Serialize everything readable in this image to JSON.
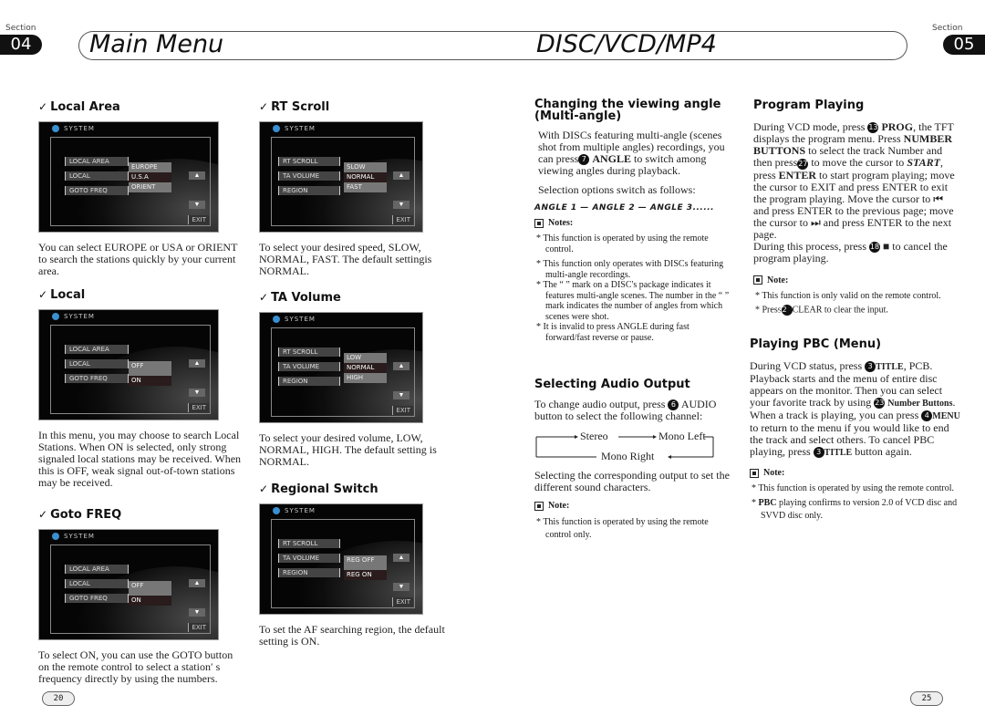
{
  "left_page": {
    "section_label": "Section",
    "section_number": "04",
    "title": "Main Menu",
    "page_number": "20",
    "sections": [
      {
        "heading": "Local Area",
        "screen": {
          "header": "SYSTEM",
          "menu_items": [
            "LOCAL AREA",
            "LOCAL",
            "GOTO FREQ"
          ],
          "options": [
            "EUROPE",
            "U.S.A",
            "ORIENT"
          ],
          "selected_option": "U.S.A",
          "exit_label": "EXIT"
        },
        "description": "You can select EUROPE or USA or ORIENT to search the stations quickly by your current area."
      },
      {
        "heading": "Local",
        "screen": {
          "header": "SYSTEM",
          "menu_items": [
            "LOCAL AREA",
            "LOCAL",
            "GOTO FREQ"
          ],
          "options": [
            "OFF",
            "ON"
          ],
          "selected_option": "ON",
          "exit_label": "EXIT"
        },
        "description": "In this menu, you may choose to search Local Stations. When ON is selected, only strong signaled local stations may be received. When this is OFF, weak signal out-of-town stations may be received."
      },
      {
        "heading": "Goto FREQ",
        "screen": {
          "header": "SYSTEM",
          "menu_items": [
            "LOCAL AREA",
            "LOCAL",
            "GOTO FREQ"
          ],
          "options": [
            "OFF",
            "ON"
          ],
          "selected_option": "ON",
          "exit_label": "EXIT"
        },
        "description": "To select ON, you can use the GOTO button on the remote control to select a station′ s frequency directly by using the numbers."
      },
      {
        "heading": "RT Scroll",
        "screen": {
          "header": "SYSTEM",
          "menu_items": [
            "RT SCROLL",
            "TA VOLUME",
            "REGION"
          ],
          "options": [
            "SLOW",
            "NORMAL",
            "FAST"
          ],
          "selected_option": "NORMAL",
          "exit_label": "EXIT"
        },
        "description": "To select your desired speed, SLOW, NORMAL, FAST. The default settingis NORMAL."
      },
      {
        "heading": "TA Volume",
        "screen": {
          "header": "SYSTEM",
          "menu_items": [
            "RT SCROLL",
            "TA VOLUME",
            "REGION"
          ],
          "options": [
            "LOW",
            "NORMAL",
            "HIGH"
          ],
          "selected_option": "NORMAL",
          "exit_label": "EXIT"
        },
        "description": "To select your desired volume, LOW, NORMAL, HIGH. The default setting is NORMAL."
      },
      {
        "heading": "Regional Switch",
        "screen": {
          "header": "SYSTEM",
          "menu_items": [
            "RT SCROLL",
            "TA VOLUME",
            "REGION"
          ],
          "options": [
            "REG OFF",
            "REG ON"
          ],
          "selected_option": "REG ON",
          "exit_label": "EXIT"
        },
        "description": "To set the AF searching region, the default setting is ON."
      }
    ]
  },
  "right_page": {
    "section_label": "Section",
    "section_number": "05",
    "title": "DISC/VCD/MP4",
    "page_number": "25",
    "multi_angle": {
      "heading": "Changing the viewing angle (Multi-angle)",
      "p1_a": "With DISCs featuring multi-angle (scenes shot from multiple angles) recordings, you can press",
      "p1_num": "7",
      "p1_bold": "ANGLE",
      "p1_b": "to switch among viewing angles during playback.",
      "p2": "Selection options switch as follows:",
      "angle_sequence": [
        "ANGLE 1",
        "ANGLE 2",
        "ANGLE 3......"
      ],
      "notes_label": "Notes:",
      "notes": [
        "This function is operated by using the remote control.",
        "This function only operates with DISCs featuring multi-angle recordings.",
        "The “ ” mark on a DISC's package indicates it features multi-angle scenes. The number in the “ ” mark indicates the number of angles from which scenes were shot.",
        "It is invalid to press ANGLE during fast forward/fast reverse or pause."
      ]
    },
    "audio_output": {
      "heading": "Selecting Audio Output",
      "p1_a": "To change audio output, press",
      "p1_num": "6",
      "p1_b": "AUDIO button to select the following channel:",
      "cycle": [
        "Stereo",
        "Mono Left",
        "Mono Right"
      ],
      "p2": "Selecting the corresponding output to set the different sound characters.",
      "note_label": "Note:",
      "notes": [
        "This function is operated by using the remote control only."
      ]
    },
    "program_playing": {
      "heading": "Program Playing",
      "p1_a": "During VCD mode, press",
      "p1_num1": "13",
      "p1_bold1": "PROG",
      "p1_b": ", the TFT displays the program menu. Press",
      "p1_bold2": "NUMBER BUTTONS",
      "p1_c": "to select the track Number and then press",
      "p1_num2": "27",
      "p1_d": "to move the cursor to",
      "p1_bold3": "START",
      "p1_e": ", press",
      "p1_bold4": "ENTER",
      "p1_f": "to start program playing; move the cursor to EXIT and press ENTER to exit the program playing. Move the cursor to ⏮ and press ENTER to the previous page; move the cursor to ⏭ and press ENTER to the next page.",
      "p2_a": "During this process, press",
      "p2_num": "18",
      "p2_b": "■ to cancel the program playing.",
      "note_label": "Note:",
      "notes": [
        "This function is only valid on the remote control.",
        "CLEAR to clear the input."
      ],
      "note2_prefix": "Press",
      "note2_num": "22"
    },
    "pbc": {
      "heading": "Playing PBC (Menu)",
      "p1_a": "During VCD status, press",
      "p1_num1": "3",
      "p1_bold1": "TITLE",
      "p1_b": ", PCB. Playback starts and the menu of entire disc appears on the monitor. Then you can select your favorite track by using",
      "p1_num2": "23",
      "p1_bold2": "Number Buttons",
      "p1_c": ". When a track is playing, you can press",
      "p1_num3": "4",
      "p1_bold3": "MENU",
      "p1_d": "to return to the menu if you would like to end the track and select others. To cancel PBC playing, press",
      "p1_num4": "3",
      "p1_bold4": "TITLE",
      "p1_e": "button again.",
      "note_label": "Note:",
      "notes": [
        "This function is operated by using the remote control.",
        "playing confirms to version 2.0 of VCD disc and SVVD disc only."
      ],
      "note2_bold": "PBC"
    }
  }
}
